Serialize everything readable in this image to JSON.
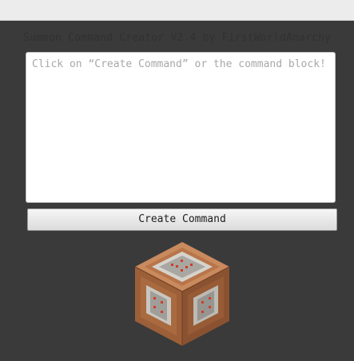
{
  "app": {
    "title": "Summon Command Creator V2.4 by FirstWorldAnarchy"
  },
  "command_box": {
    "value": "",
    "placeholder": "Click on “Create Command” or the command block!"
  },
  "create_button": {
    "label": "Create Command"
  },
  "command_block": {
    "icon": "command-block-icon"
  },
  "colors": {
    "background": "#3a3a3a",
    "block_orange": "#b8754a",
    "block_panel": "#d8d6d0",
    "block_red": "#d23a2c"
  }
}
